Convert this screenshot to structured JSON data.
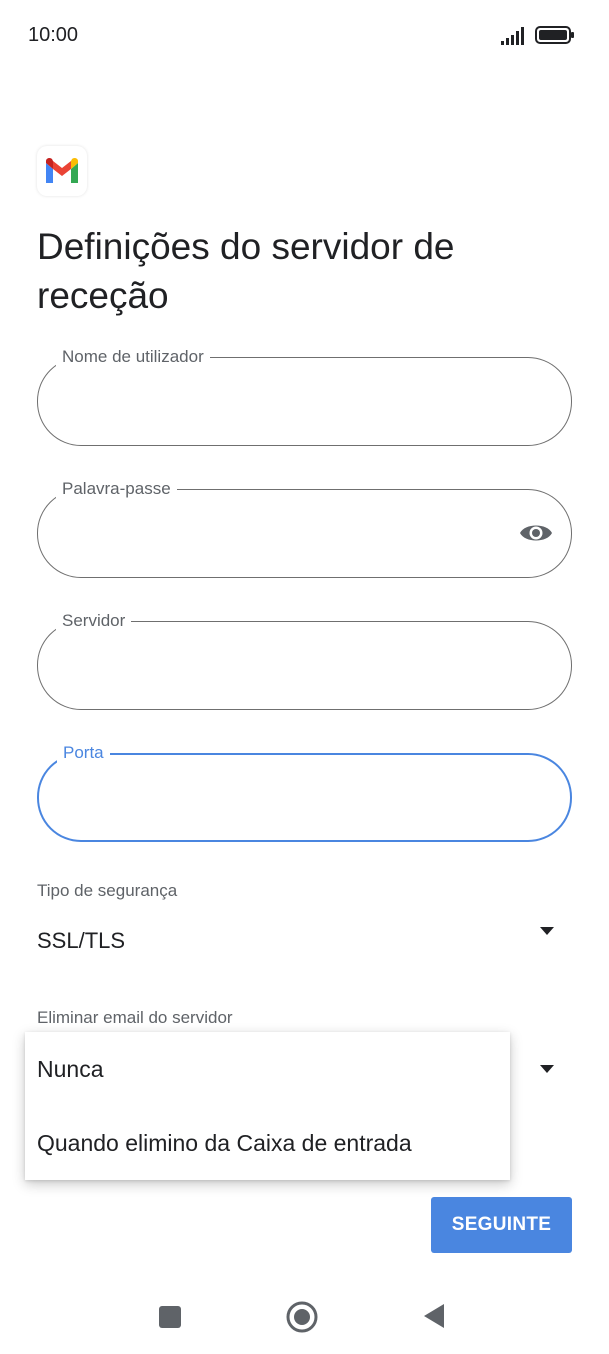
{
  "status_bar": {
    "time": "10:00"
  },
  "title": "Definições do servidor de receção",
  "fields": {
    "username": {
      "label": "Nome de utilizador",
      "value": ""
    },
    "password": {
      "label": "Palavra-passe",
      "value": ""
    },
    "server": {
      "label": "Servidor",
      "value": ""
    },
    "port": {
      "label": "Porta",
      "value": ""
    }
  },
  "security": {
    "label": "Tipo de segurança",
    "value": "SSL/TLS"
  },
  "delete_email": {
    "label": "Eliminar email do servidor",
    "options": [
      "Nunca",
      "Quando elimino da Caixa de entrada"
    ]
  },
  "next_button": "SEGUINTE",
  "colors": {
    "accent": "#4a86e0",
    "outline": "#6f6f6f"
  },
  "icons": [
    "gmail-logo",
    "signal-icon",
    "battery-icon",
    "eye-icon",
    "dropdown-arrow-icon",
    "nav-recents-icon",
    "nav-home-icon",
    "nav-back-icon"
  ]
}
